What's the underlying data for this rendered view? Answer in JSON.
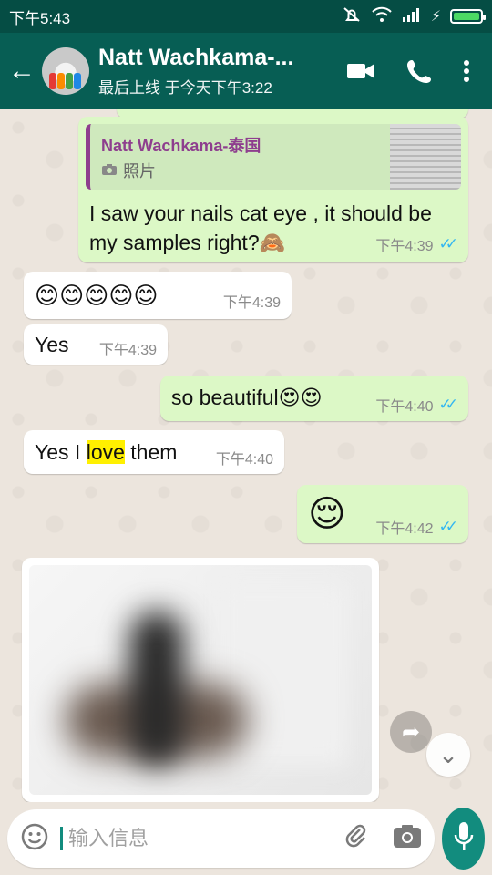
{
  "statusbar": {
    "time": "下午5:43"
  },
  "header": {
    "title": "Natt Wachkama-...",
    "subtitle": "最后上线 于今天下午3:22"
  },
  "messages": {
    "m1": {
      "reply_name": "Natt Wachkama-泰国",
      "reply_type": "照片",
      "text": "I saw your nails cat eye , it should be my samples right?",
      "emoji": "🙈",
      "time": "下午4:39"
    },
    "m2": {
      "emoji": "😊😊😊😊😊",
      "time": "下午4:39"
    },
    "m3": {
      "text": "Yes",
      "time": "下午4:39"
    },
    "m4": {
      "text": "so beautiful",
      "emoji": "😍😍",
      "time": "下午4:40"
    },
    "m5": {
      "before": "Yes I ",
      "highlight": "love",
      "after": " them",
      "time": "下午4:40"
    },
    "m6": {
      "emoji": "😌",
      "time": "下午4:42"
    }
  },
  "composer": {
    "placeholder": "输入信息"
  },
  "colors": {
    "header": "#075e54",
    "statusbar": "#054d44",
    "outgoing": "#dcf8c6",
    "incoming": "#ffffff",
    "read_ticks": "#34b7f1",
    "highlight": "#fff000"
  }
}
